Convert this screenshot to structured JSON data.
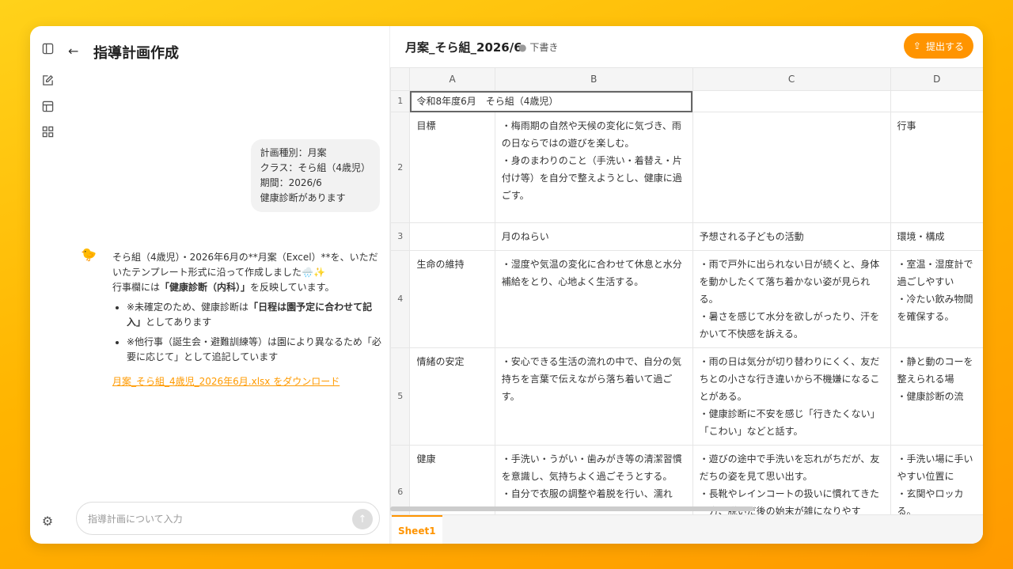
{
  "colors": {
    "accent": "#ff9400"
  },
  "rail": {
    "icons": [
      "sidebar-toggle-icon",
      "edit-icon",
      "table-icon",
      "grid-icon",
      "settings-icon"
    ]
  },
  "chat": {
    "title": "指導計画作成",
    "user_message": "計画種別：月案\nクラス：そら組（4歳児）\n期間：2026/6\n健康診断があります",
    "assistant": {
      "line1": "そら組（4歳児）・2026年6月の**月案（Excel）**を、いただいたテンプレート形式に沿って作成しました🌧️✨",
      "line2_pre": "行事欄には",
      "line2_bold": "「健康診断（内科）」",
      "line2_post": "を反映しています。",
      "bullet1_pre": "※未確定のため、健康診断は",
      "bullet1_bold": "「日程は園予定に合わせて記入」",
      "bullet1_post": "としてあります",
      "bullet2": "※他行事（誕生会・避難訓練等）は園により異なるため「必要に応じて」として追記しています",
      "download_link": "月案_そら組_4歳児_2026年6月.xlsx をダウンロード"
    },
    "input_placeholder": "指導計画について入力"
  },
  "sheet": {
    "doc_title": "月案_そら組_2026/6",
    "status": "下書き",
    "submit_label": "提出する",
    "columns": [
      "A",
      "B",
      "C",
      "D"
    ],
    "rows": [
      {
        "n": "1",
        "cells": [
          "令和8年度6月　そら組（4歳児）",
          "",
          "",
          ""
        ]
      },
      {
        "n": "2",
        "cells": [
          "目標",
          "・梅雨期の自然や天候の変化に気づき、雨の日ならではの遊びを楽しむ。\n・身のまわりのこと（手洗い・着替え・片付け等）を自分で整えようとし、健康に過ごす。",
          "",
          "行事"
        ]
      },
      {
        "n": "3",
        "cells": [
          "",
          "月のねらい",
          "予想される子どもの活動",
          "環境・構成"
        ]
      },
      {
        "n": "4",
        "cells": [
          "生命の維持",
          "・湿度や気温の変化に合わせて休息と水分補給をとり、心地よく生活する。",
          "・雨で戸外に出られない日が続くと、身体を動かしたくて落ち着かない姿が見られる。\n・暑さを感じて水分を欲しがったり、汗をかいて不快感を訴える。",
          "・室温・湿度計で過ごしやすい\n・冷たい飲み物間を確保する。"
        ]
      },
      {
        "n": "5",
        "cells": [
          "情緒の安定",
          "・安心できる生活の流れの中で、自分の気持ちを言葉で伝えながら落ち着いて過ごす。",
          "・雨の日は気分が切り替わりにくく、友だちとの小さな行き違いから不機嫌になることがある。\n・健康診断に不安を感じ「行きたくない」「こわい」などと話す。",
          "・静と動のコーを整えられる場\n・健康診断の流"
        ]
      },
      {
        "n": "6",
        "cells": [
          "健康",
          "・手洗い・うがい・歯みがき等の清潔習慣を意識し、気持ちよく過ごそうとする。\n・自分で衣服の調整や着脱を行い、濡れ",
          "・遊びの途中で手洗いを忘れがちだが、友だちの姿を見て思い出す。\n・長靴やレインコートの扱いに慣れてきた一方、脱いだ後の始末が雑になりやす",
          "・手洗い場に手いやすい位置に\n・玄関やロッカる。"
        ]
      }
    ],
    "tabs": [
      "Sheet1"
    ]
  }
}
